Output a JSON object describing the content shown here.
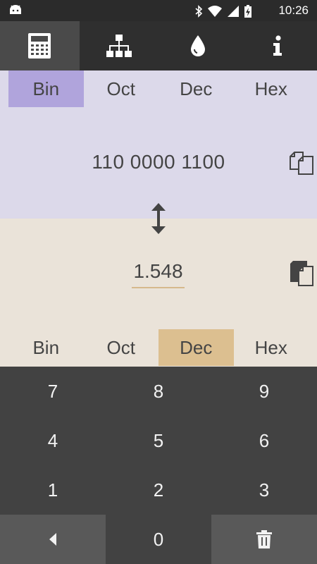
{
  "status_bar": {
    "time": "10:26",
    "icons": [
      "android-icon",
      "bluetooth-icon",
      "wifi-icon",
      "signal-icon",
      "battery-charging-icon"
    ]
  },
  "tabs": [
    {
      "name": "calculator-icon",
      "active": true
    },
    {
      "name": "hierarchy-icon",
      "active": false
    },
    {
      "name": "drop-icon",
      "active": false
    },
    {
      "name": "info-icon",
      "active": false
    }
  ],
  "top": {
    "bases": [
      "Bin",
      "Oct",
      "Dec",
      "Hex"
    ],
    "selected": "Bin",
    "value": "110 0000 1100",
    "copy_icon": "copy-icon"
  },
  "swap_icon": "swap-vertical-icon",
  "bottom": {
    "input_value": "1.548",
    "paste_icon": "paste-icon",
    "bases": [
      "Bin",
      "Oct",
      "Dec",
      "Hex"
    ],
    "selected": "Dec"
  },
  "keypad": {
    "rows": [
      [
        "7",
        "8",
        "9"
      ],
      [
        "4",
        "5",
        "6"
      ],
      [
        "1",
        "2",
        "3"
      ]
    ],
    "zero": "0",
    "back_icon": "backspace-icon",
    "delete_icon": "trash-icon"
  },
  "colors": {
    "top_panel": "#dcd9ea",
    "top_selected": "#b0a4dc",
    "bottom_panel": "#eae3d9",
    "bottom_selected": "#dcbf90",
    "keypad": "#424242",
    "tab_bar": "#2f2f2f"
  }
}
